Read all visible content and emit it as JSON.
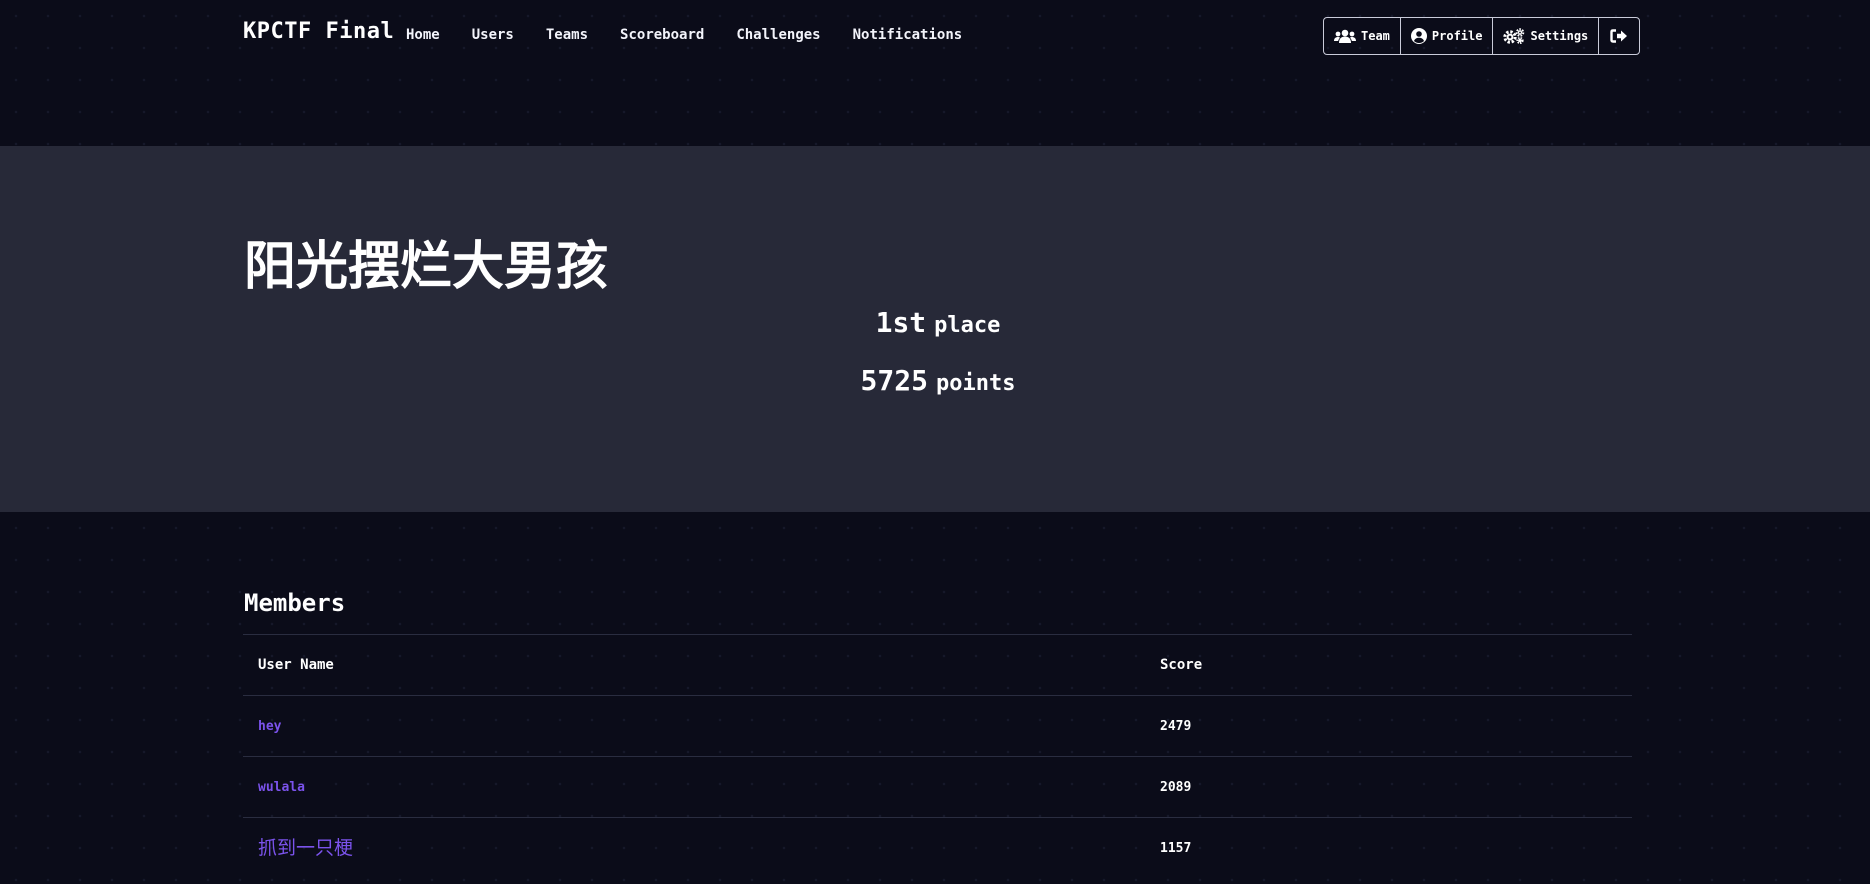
{
  "navbar": {
    "brand": "KPCTF Final",
    "links": [
      "Home",
      "Users",
      "Teams",
      "Scoreboard",
      "Challenges",
      "Notifications"
    ],
    "buttons": {
      "team": {
        "label": "Team",
        "icon": "users-icon"
      },
      "profile": {
        "label": "Profile",
        "icon": "user-circle-icon"
      },
      "settings": {
        "label": "Settings",
        "icon": "cogs-icon"
      },
      "logout": {
        "label": "",
        "icon": "sign-out-icon"
      }
    }
  },
  "team": {
    "name": "阳光摆烂大男孩",
    "place_num": "1st",
    "place_unit": "place",
    "points_num": "5725",
    "points_unit": "points"
  },
  "members": {
    "title": "Members",
    "columns": [
      "User Name",
      "Score"
    ],
    "rows": [
      {
        "name": "hey",
        "score": "2479"
      },
      {
        "name": "wulala",
        "score": "2089"
      },
      {
        "name": "抓到一只梗",
        "score": "1157"
      }
    ]
  },
  "colors": {
    "background": "#0b0c19",
    "jumbotron": "#272938",
    "link": "#7b53ec"
  }
}
